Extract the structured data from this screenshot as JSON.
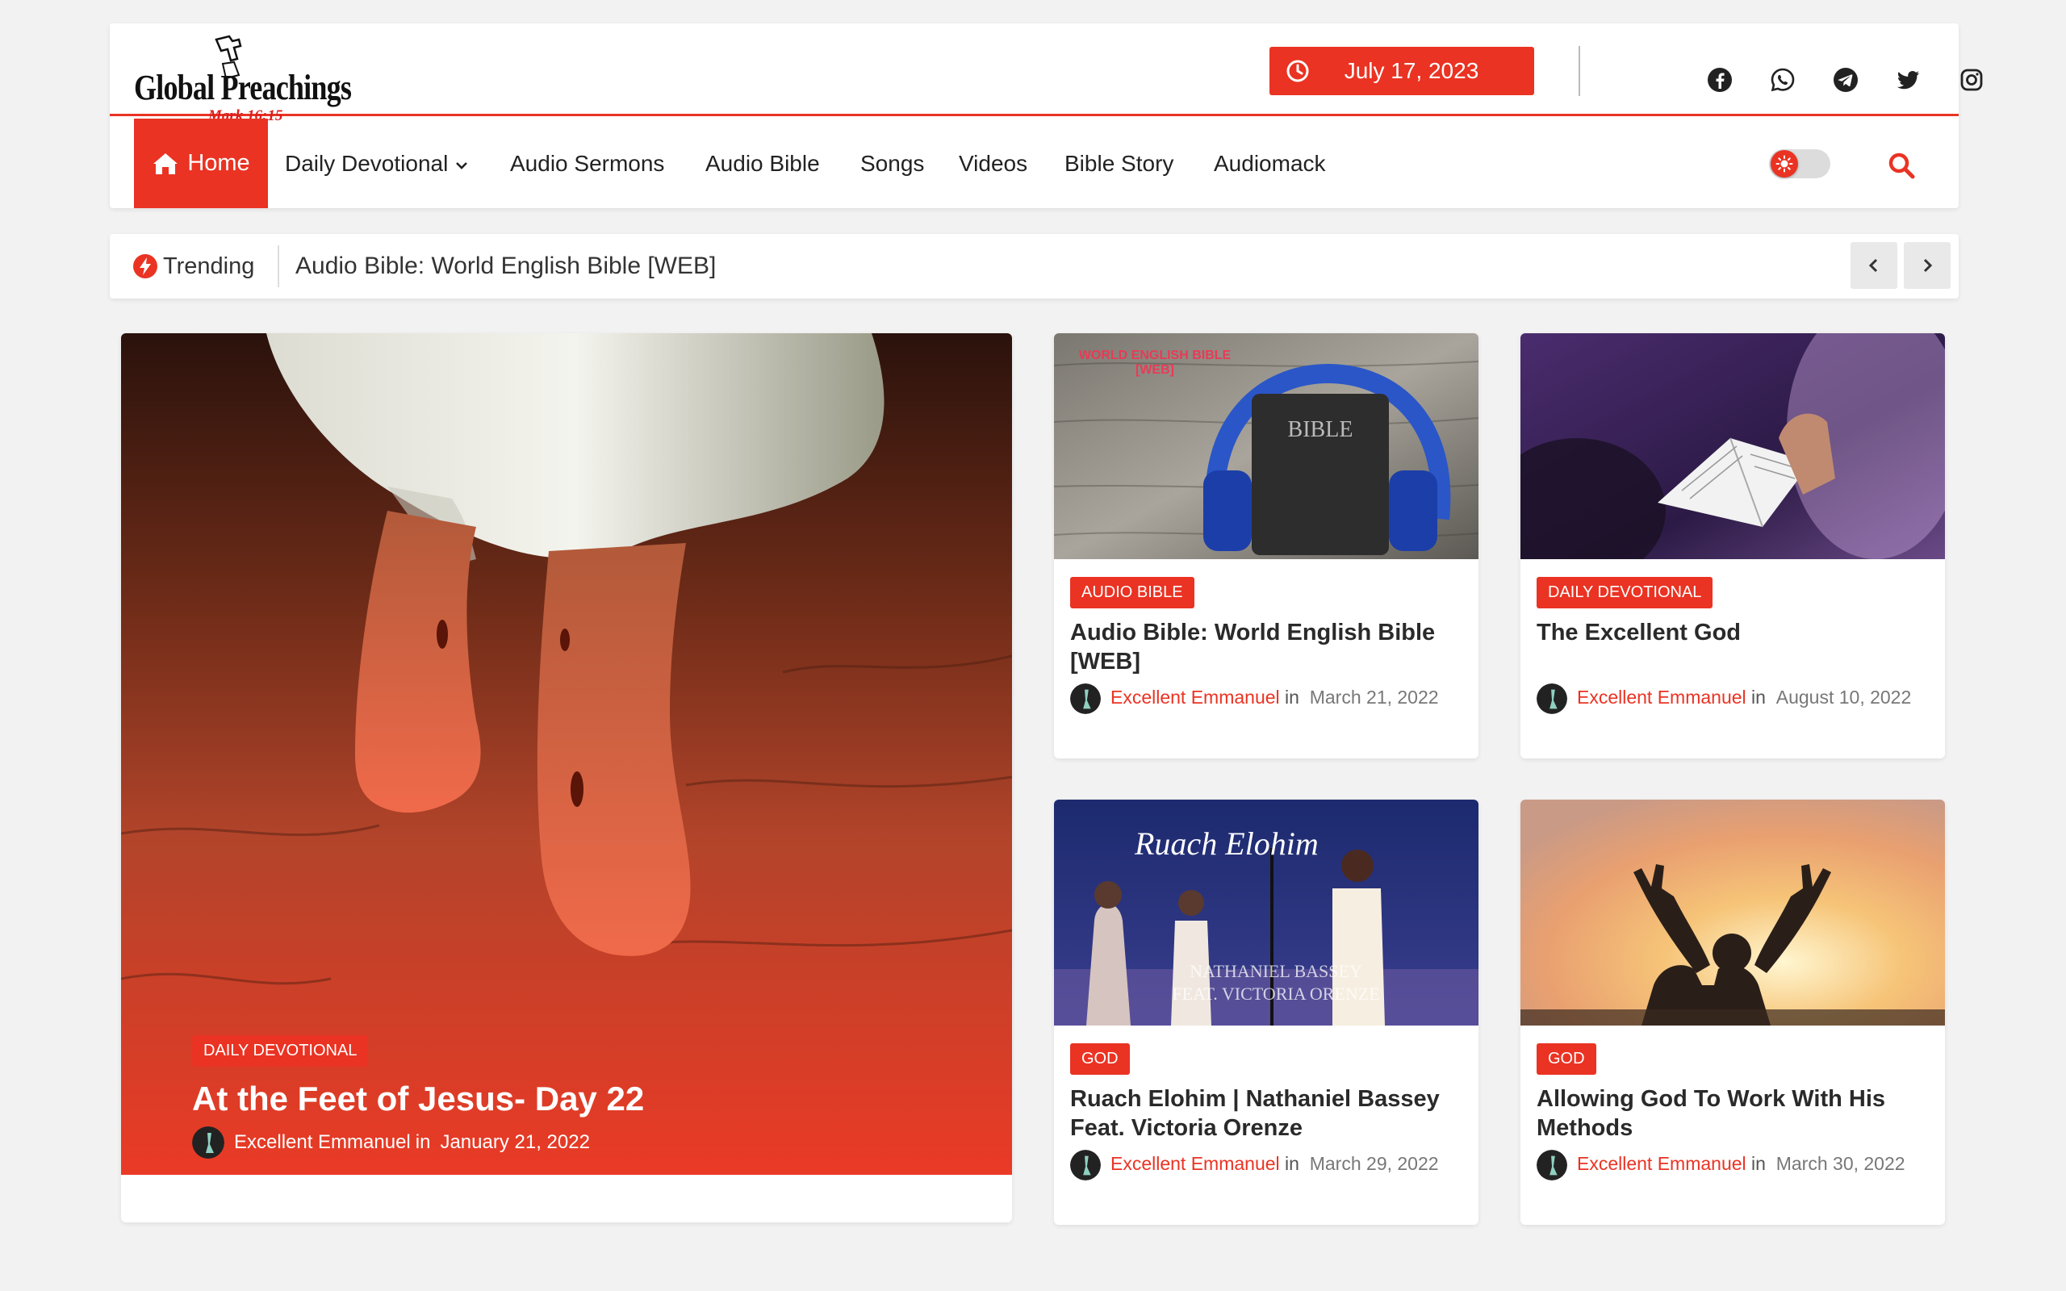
{
  "header": {
    "logo": {
      "text": "Global Preachings",
      "subtext": "Mark 16:15"
    },
    "date": "July 17, 2023",
    "social": [
      "facebook-icon",
      "whatsapp-icon",
      "telegram-icon",
      "twitter-icon",
      "instagram-icon"
    ]
  },
  "nav": {
    "items": [
      "Home",
      "Daily Devotional",
      "Audio Sermons",
      "Audio Bible",
      "Songs",
      "Videos",
      "Bible Story",
      "Audiomack"
    ],
    "active": "Home"
  },
  "trending": {
    "label": "Trending",
    "headline": "Audio Bible: World English Bible [WEB]"
  },
  "featured": {
    "category": "DAILY DEVOTIONAL",
    "title": "At the Feet of Jesus- Day 22",
    "author": "Excellent Emmanuel",
    "in": "in",
    "date": "January 21, 2022"
  },
  "cards": [
    {
      "category": "AUDIO BIBLE",
      "title": "Audio Bible: World English Bible [WEB]",
      "author": "Excellent Emmanuel",
      "in": "in",
      "date": "March 21, 2022",
      "image_text": [
        "WORLD ENGLISH BIBLE",
        "[WEB]",
        "BIBLE"
      ]
    },
    {
      "category": "DAILY DEVOTIONAL",
      "title": "The Excellent God",
      "author": "Excellent Emmanuel",
      "in": "in",
      "date": "August 10, 2022"
    },
    {
      "category": "GOD",
      "title": "Ruach Elohim | Nathaniel Bassey Feat. Victoria Orenze",
      "author": "Excellent Emmanuel",
      "in": "in",
      "date": "March 29, 2022",
      "image_text": [
        "Ruach Elohim",
        "NATHANIEL BASSEY",
        "FEAT. VICTORIA ORENZE"
      ]
    },
    {
      "category": "GOD",
      "title": "Allowing God To Work With His Methods",
      "author": "Excellent Emmanuel",
      "in": "in",
      "date": "March 30, 2022"
    }
  ],
  "colors": {
    "accent": "#ea3323",
    "background": "#f2f2f2"
  }
}
